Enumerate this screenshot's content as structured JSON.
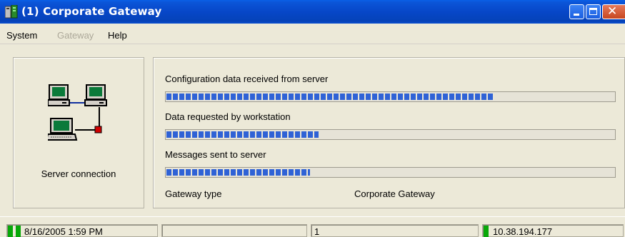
{
  "window": {
    "title": "(1) Corporate Gateway"
  },
  "menu": {
    "system": "System",
    "gateway": "Gateway",
    "help": "Help"
  },
  "connection": {
    "label": "Server connection"
  },
  "progress": [
    {
      "label": "Configuration data received from server",
      "fraction": 0.73
    },
    {
      "label": "Data requested by workstation",
      "fraction": 0.34
    },
    {
      "label": "Messages sent to server",
      "fraction": 0.32
    }
  ],
  "gateway": {
    "label": "Gateway type",
    "value": "Corporate Gateway"
  },
  "status": {
    "datetime": "8/16/2005 1:59 PM",
    "count": "1",
    "ip": "10.38.194.177"
  },
  "colors": {
    "titlebar": "#0747c8",
    "progress": "#2f62d6",
    "indicator": "#08a808"
  }
}
